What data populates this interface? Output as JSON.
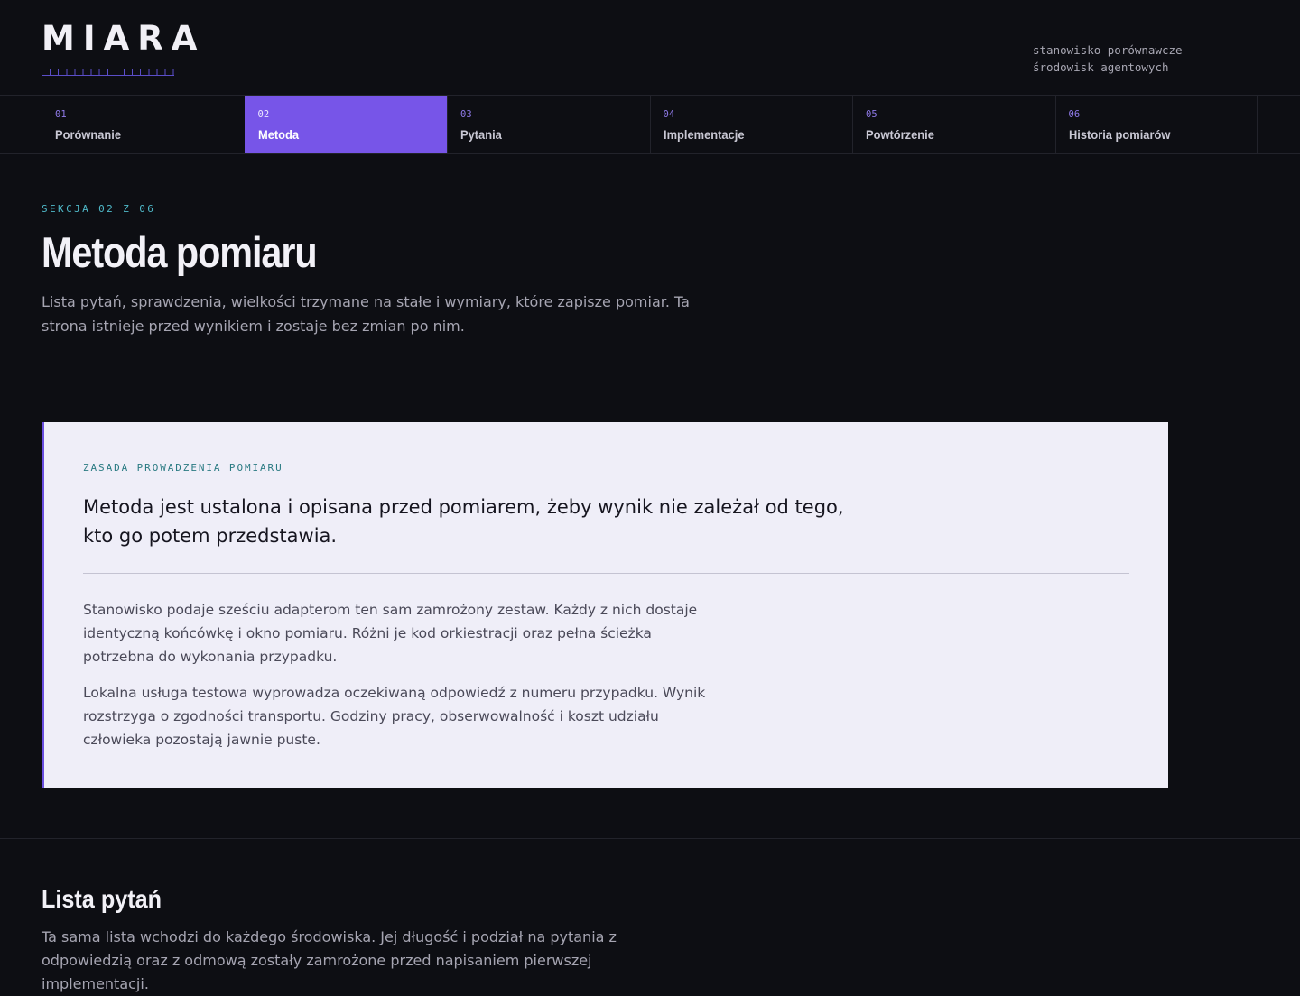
{
  "header": {
    "logo": "MIARA",
    "tagline_line1": "stanowisko porównawcze",
    "tagline_line2": "środowisk agentowych"
  },
  "tabs": [
    {
      "num": "01",
      "label": "Porównanie",
      "active": false
    },
    {
      "num": "02",
      "label": "Metoda",
      "active": true
    },
    {
      "num": "03",
      "label": "Pytania",
      "active": false
    },
    {
      "num": "04",
      "label": "Implementacje",
      "active": false
    },
    {
      "num": "05",
      "label": "Powtórzenie",
      "active": false
    },
    {
      "num": "06",
      "label": "Historia pomiarów",
      "active": false
    }
  ],
  "section": {
    "eyebrow": "SEKCJA 02 Z 06",
    "title": "Metoda pomiaru",
    "intro": "Lista pytań, sprawdzenia, wielkości trzymane na stałe i wymiary, które zapisze pomiar. Ta strona istnieje przed wynikiem i zostaje bez zmian po nim."
  },
  "principle": {
    "eyebrow": "ZASADA PROWADZENIA POMIARU",
    "lead": "Metoda jest ustalona i opisana przed pomiarem, żeby wynik nie zależał od tego, kto go potem przedstawia.",
    "paragraph1": "Stanowisko podaje sześciu adapterom ten sam zamrożony zestaw. Każdy z nich dostaje identyczną końcówkę i okno pomiaru. Różni je kod orkiestracji oraz pełna ścieżka potrzebna do wykonania przypadku.",
    "paragraph2": "Lokalna usługa testowa wyprowadza oczekiwaną odpowiedź z numeru przypadku. Wynik rozstrzyga o zgodności transportu. Godziny pracy, obserwowalność i koszt udziału człowieka pozostają jawnie puste."
  },
  "questions": {
    "title": "Lista pytań",
    "description": "Ta sama lista wchodzi do każdego środowiska. Jej długość i podział na pytania z odpowiedzią oraz z odmową zostały zamrożone przed napisaniem pierwszej implementacji."
  },
  "colors": {
    "background": "#0d0e13",
    "accent": "#7755e8",
    "eyebrow_teal": "#4fb9c9",
    "card_background": "#efeef8"
  }
}
